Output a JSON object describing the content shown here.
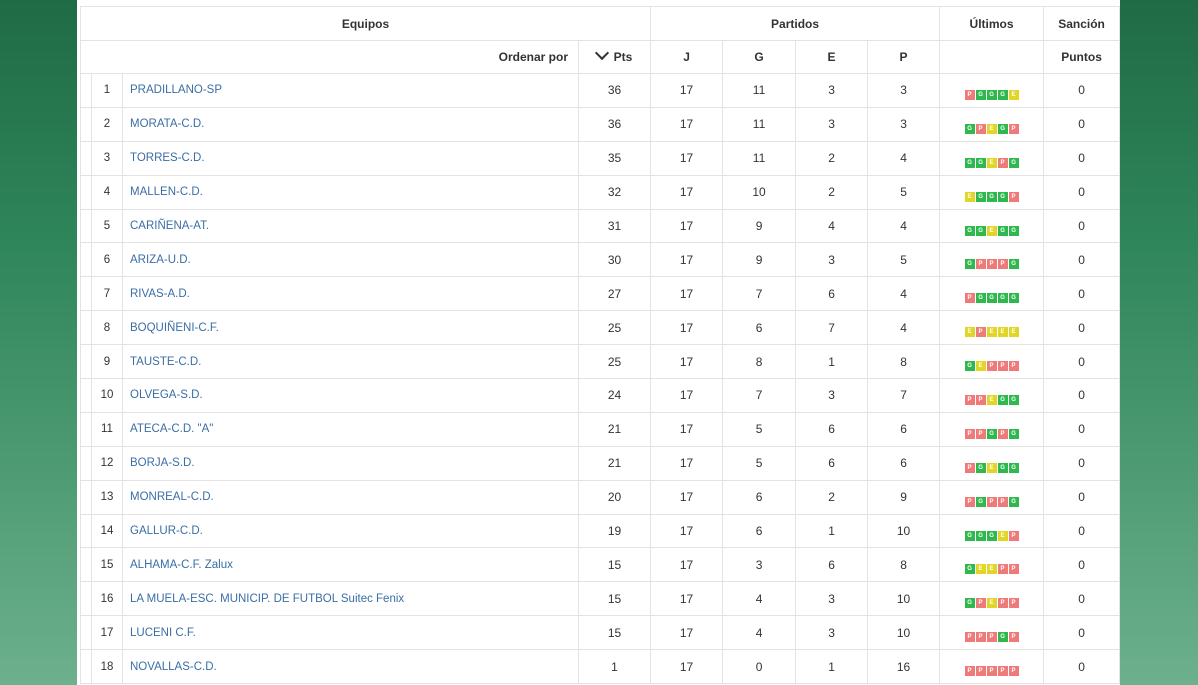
{
  "header": {
    "equipos": "Equipos",
    "partidos": "Partidos",
    "ultimos": "Últimos",
    "sancion": "Sanción",
    "ordenar_por": "Ordenar por",
    "pts": "Pts",
    "j": "J",
    "g": "G",
    "e": "E",
    "p": "P",
    "puntos": "Puntos"
  },
  "colors": {
    "win": "#2fb84e",
    "draw": "#e1d525",
    "loss": "#ef7a7a",
    "link": "#3a6ea5"
  },
  "rows": [
    {
      "pos": "1",
      "team": "PRADILLANO-SP",
      "pts": "36",
      "j": "17",
      "g": "11",
      "e": "3",
      "p": "3",
      "last": [
        "P",
        "G",
        "G",
        "G",
        "E"
      ],
      "sancion": "0"
    },
    {
      "pos": "2",
      "team": "MORATA-C.D.",
      "pts": "36",
      "j": "17",
      "g": "11",
      "e": "3",
      "p": "3",
      "last": [
        "G",
        "P",
        "E",
        "G",
        "P"
      ],
      "sancion": "0"
    },
    {
      "pos": "3",
      "team": "TORRES-C.D.",
      "pts": "35",
      "j": "17",
      "g": "11",
      "e": "2",
      "p": "4",
      "last": [
        "G",
        "G",
        "E",
        "P",
        "G"
      ],
      "sancion": "0"
    },
    {
      "pos": "4",
      "team": "MALLEN-C.D.",
      "pts": "32",
      "j": "17",
      "g": "10",
      "e": "2",
      "p": "5",
      "last": [
        "E",
        "G",
        "G",
        "G",
        "P"
      ],
      "sancion": "0"
    },
    {
      "pos": "5",
      "team": "CARIÑENA-AT.",
      "pts": "31",
      "j": "17",
      "g": "9",
      "e": "4",
      "p": "4",
      "last": [
        "G",
        "G",
        "E",
        "G",
        "G"
      ],
      "sancion": "0"
    },
    {
      "pos": "6",
      "team": "ARIZA-U.D.",
      "pts": "30",
      "j": "17",
      "g": "9",
      "e": "3",
      "p": "5",
      "last": [
        "G",
        "P",
        "P",
        "P",
        "G"
      ],
      "sancion": "0"
    },
    {
      "pos": "7",
      "team": "RIVAS-A.D.",
      "pts": "27",
      "j": "17",
      "g": "7",
      "e": "6",
      "p": "4",
      "last": [
        "P",
        "G",
        "G",
        "G",
        "G"
      ],
      "sancion": "0"
    },
    {
      "pos": "8",
      "team": "BOQUIÑENI-C.F.",
      "pts": "25",
      "j": "17",
      "g": "6",
      "e": "7",
      "p": "4",
      "last": [
        "E",
        "P",
        "E",
        "E",
        "E"
      ],
      "sancion": "0"
    },
    {
      "pos": "9",
      "team": "TAUSTE-C.D.",
      "pts": "25",
      "j": "17",
      "g": "8",
      "e": "1",
      "p": "8",
      "last": [
        "G",
        "E",
        "P",
        "P",
        "P"
      ],
      "sancion": "0"
    },
    {
      "pos": "10",
      "team": "OLVEGA-S.D.",
      "pts": "24",
      "j": "17",
      "g": "7",
      "e": "3",
      "p": "7",
      "last": [
        "P",
        "P",
        "E",
        "G",
        "G"
      ],
      "sancion": "0"
    },
    {
      "pos": "11",
      "team": "ATECA-C.D. \"A\"",
      "pts": "21",
      "j": "17",
      "g": "5",
      "e": "6",
      "p": "6",
      "last": [
        "P",
        "P",
        "G",
        "P",
        "G"
      ],
      "sancion": "0"
    },
    {
      "pos": "12",
      "team": "BORJA-S.D.",
      "pts": "21",
      "j": "17",
      "g": "5",
      "e": "6",
      "p": "6",
      "last": [
        "P",
        "G",
        "E",
        "G",
        "G"
      ],
      "sancion": "0"
    },
    {
      "pos": "13",
      "team": "MONREAL-C.D.",
      "pts": "20",
      "j": "17",
      "g": "6",
      "e": "2",
      "p": "9",
      "last": [
        "P",
        "G",
        "P",
        "P",
        "G"
      ],
      "sancion": "0"
    },
    {
      "pos": "14",
      "team": "GALLUR-C.D.",
      "pts": "19",
      "j": "17",
      "g": "6",
      "e": "1",
      "p": "10",
      "last": [
        "G",
        "G",
        "G",
        "E",
        "P"
      ],
      "sancion": "0"
    },
    {
      "pos": "15",
      "team": "ALHAMA-C.F. Zalux",
      "pts": "15",
      "j": "17",
      "g": "3",
      "e": "6",
      "p": "8",
      "last": [
        "G",
        "E",
        "E",
        "P",
        "P"
      ],
      "sancion": "0"
    },
    {
      "pos": "16",
      "team": "LA MUELA-ESC. MUNICIP. DE FUTBOL Suitec Fenix",
      "pts": "15",
      "j": "17",
      "g": "4",
      "e": "3",
      "p": "10",
      "last": [
        "G",
        "P",
        "E",
        "P",
        "P"
      ],
      "sancion": "0"
    },
    {
      "pos": "17",
      "team": "LUCENI C.F.",
      "pts": "15",
      "j": "17",
      "g": "4",
      "e": "3",
      "p": "10",
      "last": [
        "P",
        "P",
        "P",
        "G",
        "P"
      ],
      "sancion": "0"
    },
    {
      "pos": "18",
      "team": "NOVALLAS-C.D.",
      "pts": "1",
      "j": "17",
      "g": "0",
      "e": "1",
      "p": "16",
      "last": [
        "P",
        "P",
        "P",
        "P",
        "P"
      ],
      "sancion": "0"
    }
  ]
}
